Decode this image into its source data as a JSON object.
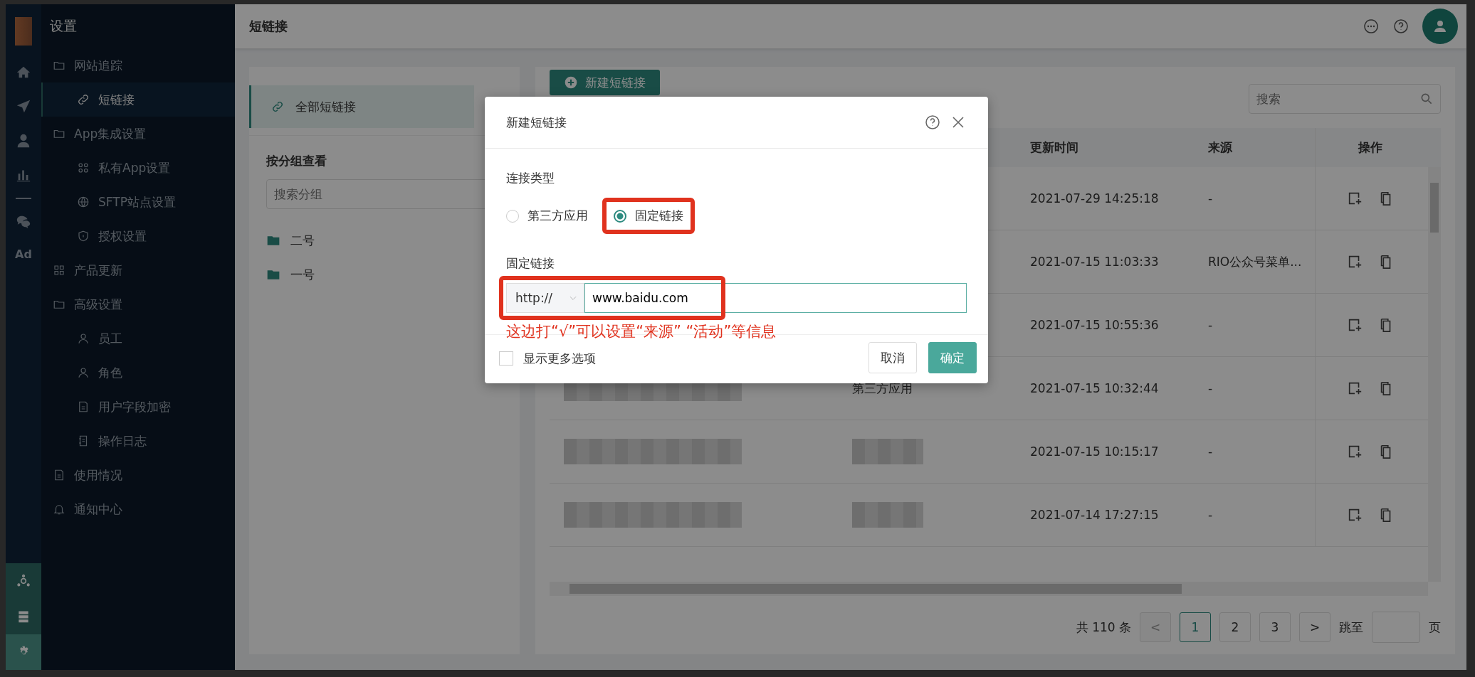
{
  "sidebar": {
    "title": "设置",
    "rail_label": "Ad",
    "rail_bottom": [
      {
        "selected": false
      },
      {
        "selected": false
      },
      {
        "selected": true
      }
    ],
    "items": [
      {
        "label": "网站追踪",
        "selected": false,
        "children": [
          {
            "label": "短链接",
            "selected": true
          }
        ]
      },
      {
        "label": "App集成设置",
        "selected": false,
        "children": [
          {
            "label": "私有App设置",
            "selected": false
          },
          {
            "label": "SFTP站点设置",
            "selected": false
          },
          {
            "label": "授权设置",
            "selected": false
          }
        ]
      },
      {
        "label": "产品更新",
        "selected": false
      },
      {
        "label": "高级设置",
        "selected": false,
        "children": [
          {
            "label": "员工",
            "selected": false
          },
          {
            "label": "角色",
            "selected": false
          },
          {
            "label": "用户字段加密",
            "selected": false
          },
          {
            "label": "操作日志",
            "selected": false
          }
        ]
      },
      {
        "label": "使用情况",
        "selected": false
      },
      {
        "label": "通知中心",
        "selected": false
      }
    ]
  },
  "topbar": {
    "title": "短链接"
  },
  "groups_panel": {
    "all_item": {
      "label": "全部短链接",
      "selected": true
    },
    "heading": "按分组查看",
    "search": {
      "placeholder": "搜索分组"
    },
    "groups": [
      {
        "label": "二号"
      },
      {
        "label": "一号"
      }
    ]
  },
  "links_panel": {
    "new_button": "新建短链接",
    "search": {
      "placeholder": "搜索"
    },
    "table": {
      "columns": [
        "更新时间",
        "来源",
        "操作"
      ],
      "rows": [
        {
          "updated": "2021-07-29 14:25:18",
          "source": "-"
        },
        {
          "updated": "2021-07-15 11:03:33",
          "source": "RIO公众号菜单..."
        },
        {
          "updated": "2021-07-15 10:55:36",
          "source": "-"
        },
        {
          "name_redacted": true,
          "type": "第三方应用",
          "updated": "2021-07-15 10:32:44",
          "source": "-"
        },
        {
          "name_redacted": true,
          "type_redacted": true,
          "updated": "2021-07-15 10:15:17",
          "source": "-"
        },
        {
          "name_redacted": true,
          "type_redacted": true,
          "updated": "2021-07-14 17:27:15",
          "source": "-"
        }
      ]
    },
    "pagination": {
      "total": "共 110 条",
      "prev": "<",
      "prev_disabled": true,
      "pages": [
        {
          "label": "1",
          "selected": true
        },
        {
          "label": "2",
          "selected": false
        },
        {
          "label": "3",
          "selected": false
        }
      ],
      "next": ">",
      "jump_label": "跳至",
      "page_unit": "页"
    }
  },
  "modal": {
    "title": "新建短链接",
    "type_label": "连接类型",
    "types": [
      {
        "label": "第三方应用",
        "selected": false,
        "highlighted": false
      },
      {
        "label": "固定链接",
        "selected": true,
        "highlighted": true
      }
    ],
    "link_label": "固定链接",
    "protocol": "http://",
    "url": "www.baidu.com",
    "url_highlighted": true,
    "annotation": "这边打“√”可以设置“来源” “活动”等信息",
    "more_options": {
      "label": "显示更多选项",
      "checked": false
    },
    "cancel": "取消",
    "ok": "确定"
  }
}
